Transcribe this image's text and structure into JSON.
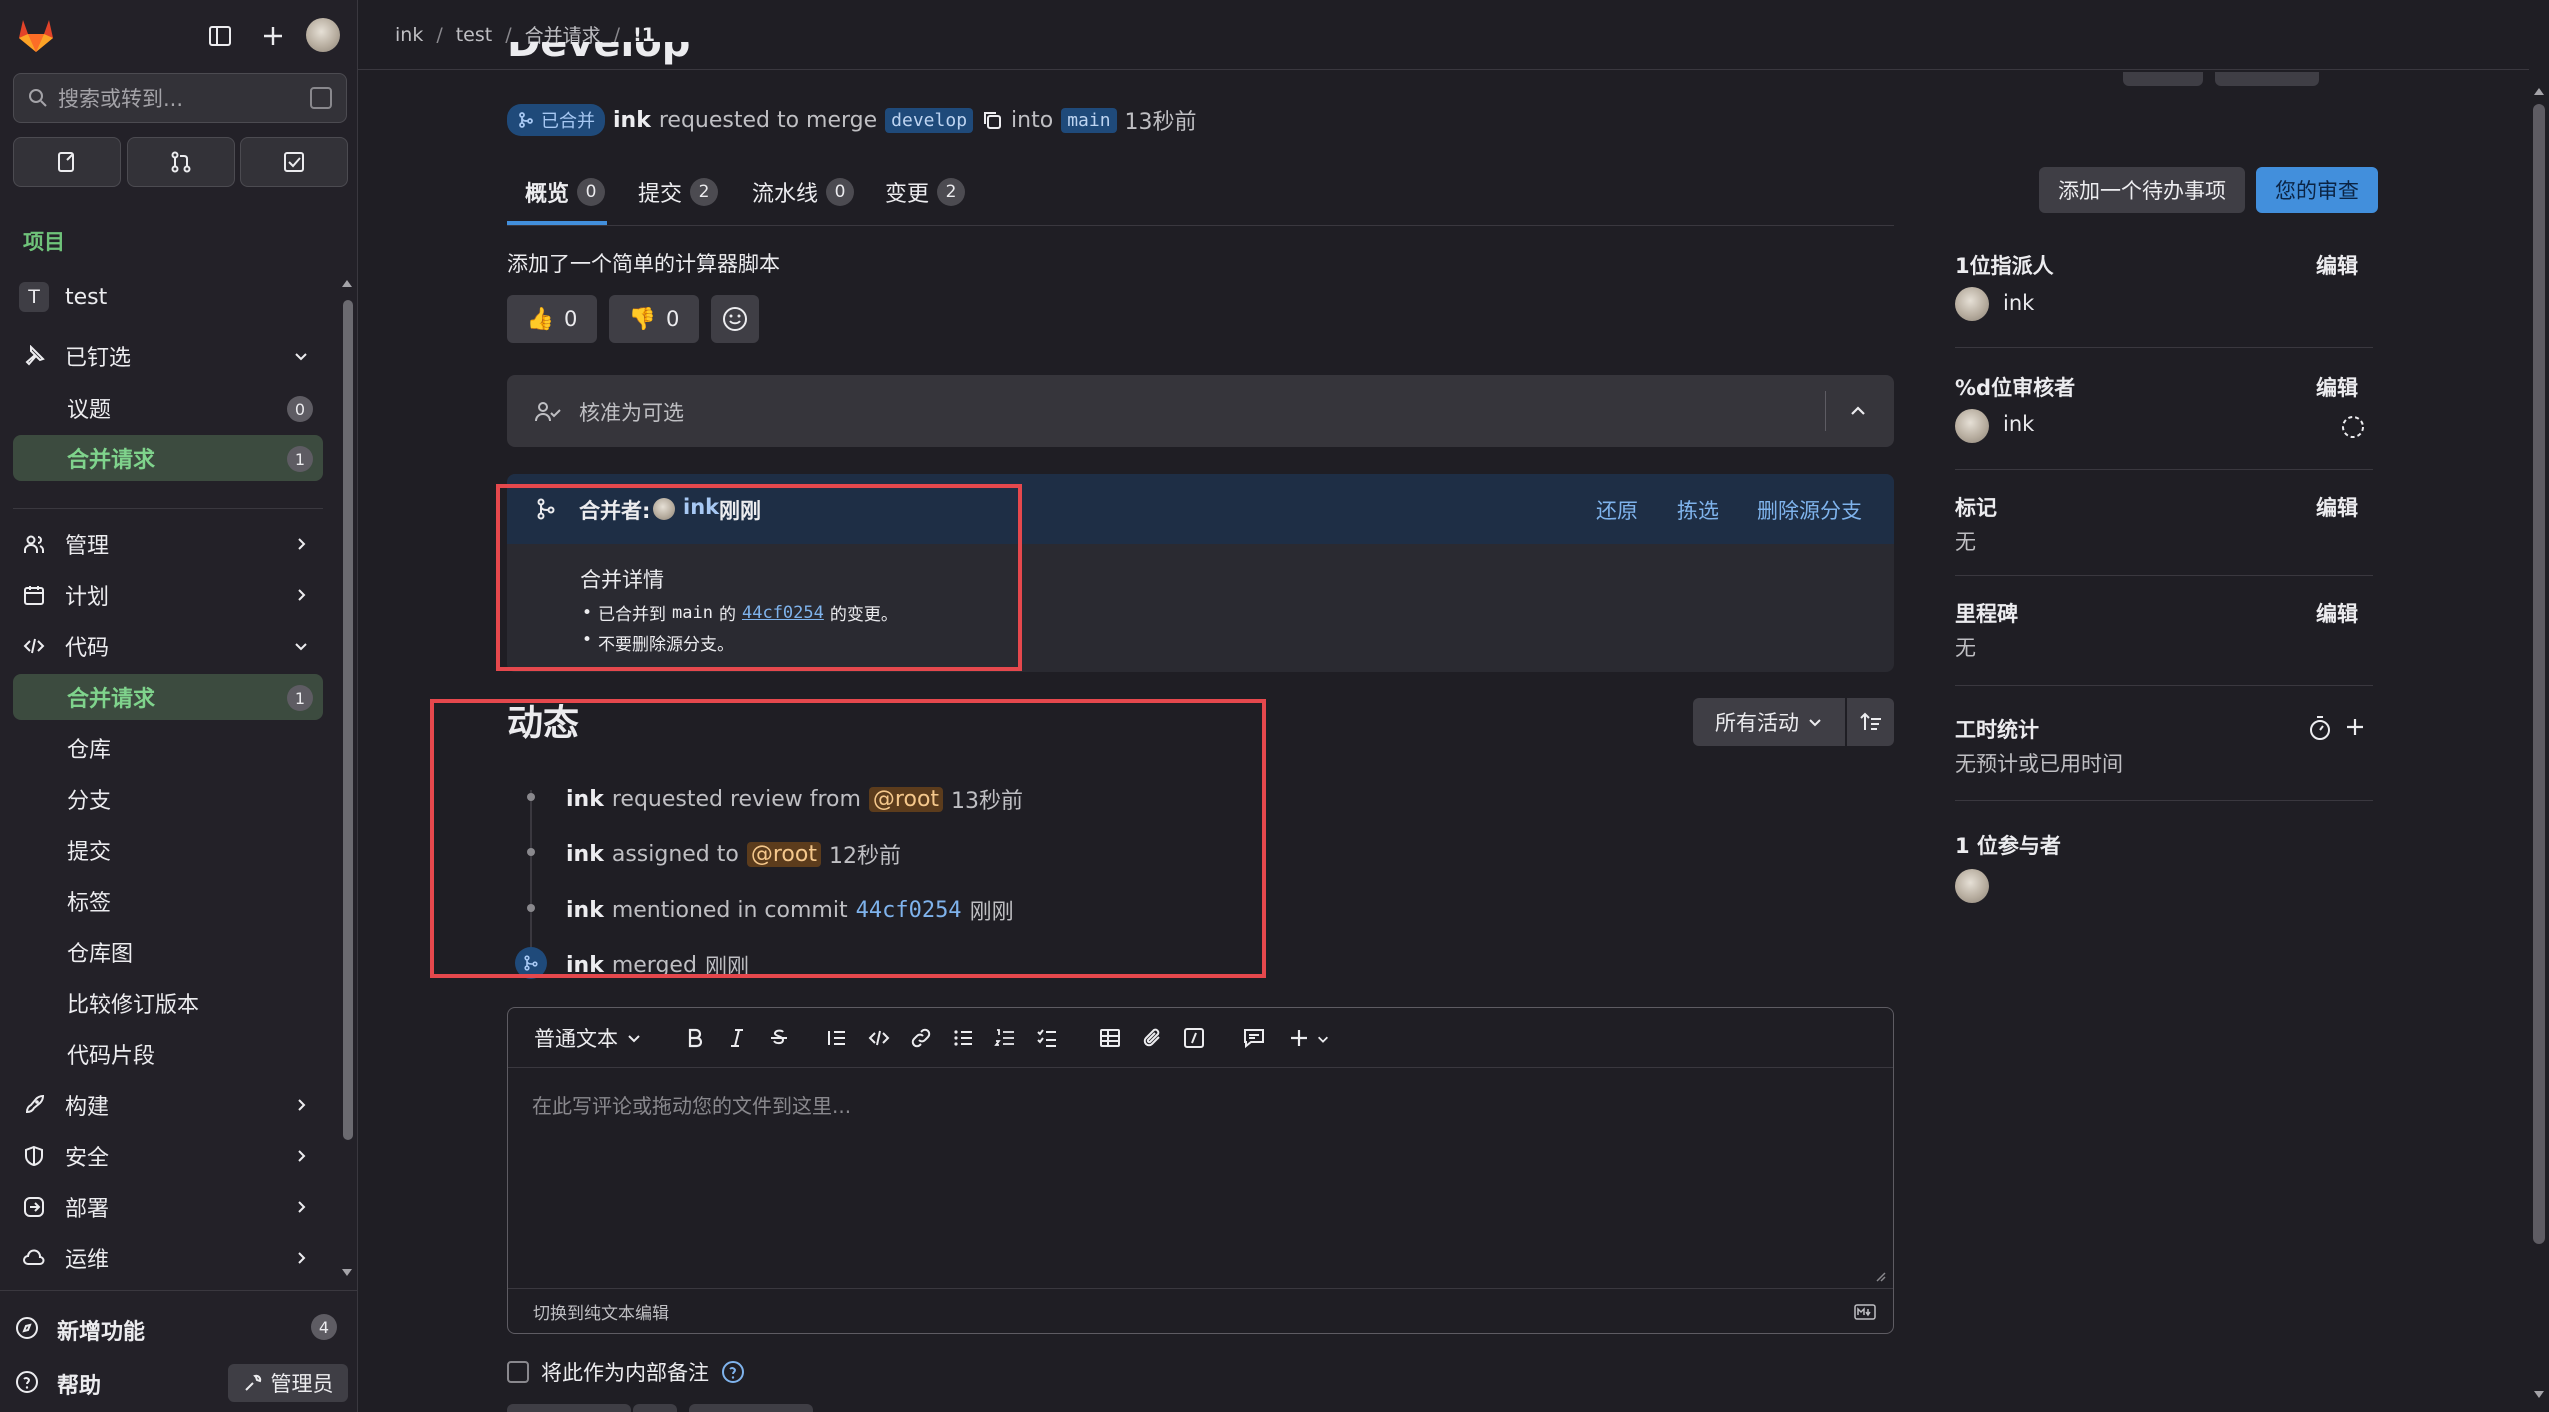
{
  "breadcrumb": {
    "items": [
      "ink",
      "test",
      "合并请求",
      "!1"
    ]
  },
  "sidebar": {
    "search_placeholder": "搜索或转到...",
    "section_label": "项目",
    "project_initial": "T",
    "project_name": "test",
    "pinned": {
      "label": "已钉选",
      "items": [
        {
          "label": "议题",
          "count": "0"
        },
        {
          "label": "合并请求",
          "count": "1"
        }
      ]
    },
    "groups": [
      {
        "label": "管理"
      },
      {
        "label": "计划"
      },
      {
        "label": "代码",
        "items": [
          {
            "label": "合并请求",
            "count": "1"
          },
          {
            "label": "仓库"
          },
          {
            "label": "分支"
          },
          {
            "label": "提交"
          },
          {
            "label": "标签"
          },
          {
            "label": "仓库图"
          },
          {
            "label": "比较修订版本"
          },
          {
            "label": "代码片段"
          }
        ]
      },
      {
        "label": "构建"
      },
      {
        "label": "安全"
      },
      {
        "label": "部署"
      },
      {
        "label": "运维"
      }
    ],
    "whats_new": {
      "label": "新增功能",
      "count": "4"
    },
    "help": "帮助",
    "admin": "管理员"
  },
  "mr": {
    "title": "Develop",
    "status": "已合并",
    "author": "ink",
    "requested_text": "requested to merge",
    "source_branch": "develop",
    "into_text": "into",
    "target_branch": "main",
    "time": "13秒前",
    "tabs": [
      {
        "label": "概览",
        "count": "0"
      },
      {
        "label": "提交",
        "count": "2"
      },
      {
        "label": "流水线",
        "count": "0"
      },
      {
        "label": "变更",
        "count": "2"
      }
    ],
    "add_todo": "添加一个待办事项",
    "your_review": "您的审查",
    "description": "添加了一个简单的计算器脚本",
    "thumbs_up": "0",
    "thumbs_down": "0",
    "approval": "核准为可选",
    "merged": {
      "label": "合并者:",
      "user": "ink",
      "time": "刚刚",
      "revert": "还原",
      "cherry_pick": "拣选",
      "delete_branch": "删除源分支",
      "details_title": "合并详情",
      "detail_1_pre": "已合并到",
      "detail_1_branch": "main",
      "detail_1_mid": "的",
      "detail_1_sha": "44cf0254",
      "detail_1_post": "的变更。",
      "detail_2": "不要删除源分支。"
    },
    "activity": {
      "title": "动态",
      "filter": "所有活动",
      "items": [
        {
          "user": "ink",
          "text": "requested review from",
          "mention": "@root",
          "time": "13秒前"
        },
        {
          "user": "ink",
          "text": "assigned to",
          "mention": "@root",
          "time": "12秒前"
        },
        {
          "user": "ink",
          "text": "mentioned in commit",
          "sha": "44cf0254",
          "time": "刚刚"
        },
        {
          "user": "ink",
          "text": "merged",
          "time": "刚刚"
        }
      ]
    },
    "editor": {
      "text_style": "普通文本",
      "placeholder": "在此写评论或拖动您的文件到这里...",
      "switch": "切换到纯文本编辑",
      "internal_note": "将此作为内部备注"
    }
  },
  "right_panel": {
    "edit": "编辑",
    "assignees_title": "1位指派人",
    "assignee": "ink",
    "reviewers_title": "%d位审核者",
    "reviewer": "ink",
    "labels_title": "标记",
    "labels_value": "无",
    "milestone_title": "里程碑",
    "milestone_value": "无",
    "time_title": "工时统计",
    "time_value": "无预计或已用时间",
    "participants_title": "1 位参与者"
  },
  "colors": {
    "accent": "#428fdc",
    "highlight_box": "#e5484d",
    "merged_pill": "#1f4a7a"
  }
}
